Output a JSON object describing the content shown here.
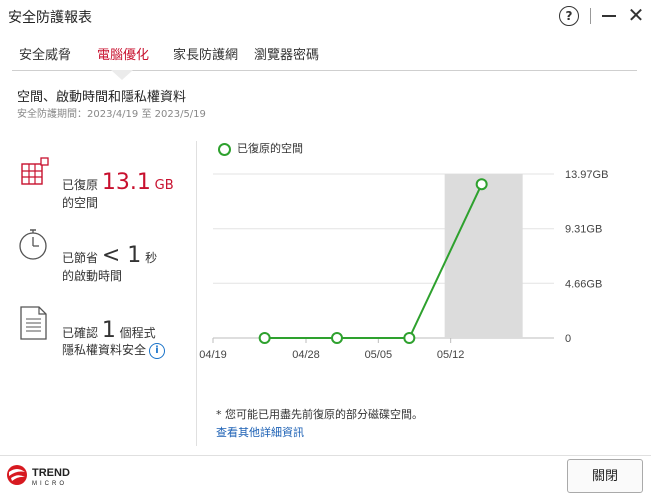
{
  "window": {
    "title": "安全防護報表",
    "help_label": "?"
  },
  "tabs": [
    {
      "label": "安全威脅",
      "active": false
    },
    {
      "label": "電腦優化",
      "active": true
    },
    {
      "label": "家長防護網",
      "active": false
    },
    {
      "label": "瀏覽器密碼",
      "active": false
    }
  ],
  "section": {
    "title": "空間、啟動時間和隱私權資料",
    "period": "安全防護期間：2023/4/19 至 2023/5/19"
  },
  "stats": {
    "space": {
      "prefix": "已復原",
      "value": "13.1",
      "unit": "GB",
      "suffix": "的空間",
      "icon": "grid-icon"
    },
    "startup": {
      "prefix": "已節省",
      "value": "< 1",
      "unit": "秒",
      "suffix": "的啟動時間",
      "icon": "stopwatch-icon"
    },
    "privacy": {
      "prefix": "已確認",
      "value": "1",
      "unit": "個程式",
      "suffix": "隱私權資料安全",
      "icon": "document-icon"
    }
  },
  "colors": {
    "accent": "#c8102e",
    "line": "#2ea12e",
    "link": "#1a5fb4",
    "highlight": "#dcdcdc"
  },
  "chart_data": {
    "type": "line",
    "legend": "已復原的空間",
    "x_ticks": [
      "04/19",
      "04/28",
      "05/05",
      "05/12"
    ],
    "y_ticks": [
      "0",
      "4.66GB",
      "9.31GB",
      "13.97GB"
    ],
    "y_tick_values": [
      0,
      4.66,
      9.31,
      13.97
    ],
    "ylim": [
      0,
      13.97
    ],
    "y_unit": "GB",
    "series": [
      {
        "x": [
          "2023-04-24",
          "2023-05-01",
          "2023-05-08",
          "2023-05-15"
        ],
        "values": [
          0,
          0,
          0,
          13.1
        ]
      }
    ],
    "highlight_x": "2023-05-15",
    "grid": true
  },
  "footer": {
    "note": "* 您可能已用盡先前復原的部分磁碟空間。",
    "link": "查看其他詳細資訊",
    "close_button": "關閉"
  },
  "logo": {
    "line1": "TREND",
    "line2": "MICRO"
  }
}
